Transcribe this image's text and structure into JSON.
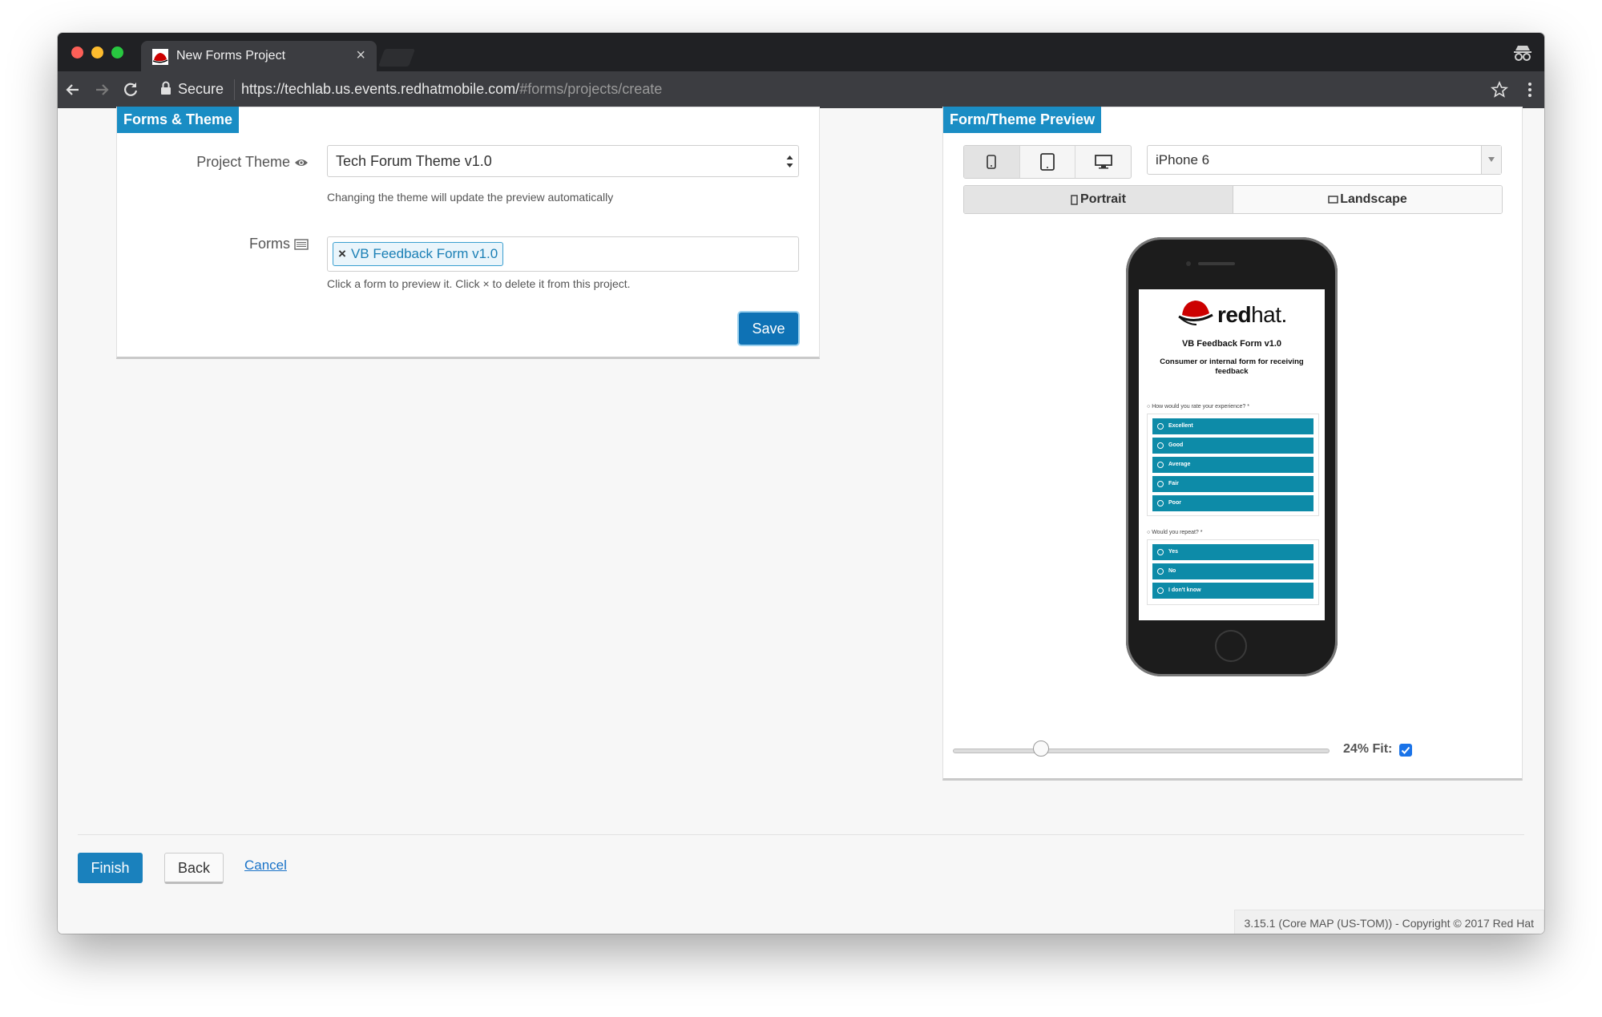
{
  "browser": {
    "tab_title": "New Forms Project",
    "tab_close": "×",
    "secure_label": "Secure",
    "url_main": "https://techlab.us.events.redhatmobile.com/",
    "url_dim": "#forms/projects/create"
  },
  "forms_panel": {
    "title": "Forms & Theme",
    "theme_label": "Project Theme",
    "theme_value": "Tech Forum Theme v1.0",
    "theme_help": "Changing the theme will update the preview automatically",
    "forms_label": "Forms",
    "form_tag_remove": "×",
    "form_tag": "VB Feedback Form v1.0",
    "forms_help": "Click a form to preview it. Click × to delete it from this project.",
    "save_label": "Save"
  },
  "preview_panel": {
    "title": "Form/Theme Preview",
    "device_select": "iPhone 6",
    "orientation": {
      "portrait": "Portrait",
      "landscape": "Landscape",
      "selected": "Portrait"
    },
    "zoom_label": "24% Fit:",
    "zoom_percent": 24,
    "fit_checked": true
  },
  "phone_form": {
    "brand": "redhat",
    "brand_bold": "red",
    "brand_light": "hat.",
    "title": "VB Feedback Form v1.0",
    "description": "Consumer or internal form for receiving feedback",
    "q1": "How would you rate your experience? *",
    "q1_options": [
      "Excellent",
      "Good",
      "Average",
      "Fair",
      "Poor"
    ],
    "q2": "Would you repeat? *",
    "q2_options": [
      "Yes",
      "No",
      "I don't know"
    ]
  },
  "actions": {
    "finish": "Finish",
    "back": "Back",
    "cancel": "Cancel"
  },
  "footer": {
    "copyright": "3.15.1 (Core MAP (US-TOM)) - Copyright © 2017 Red Hat"
  },
  "colors": {
    "accent": "#1a8dc4",
    "primary_button": "#0e72b5",
    "option_teal": "#0d8ba8"
  }
}
